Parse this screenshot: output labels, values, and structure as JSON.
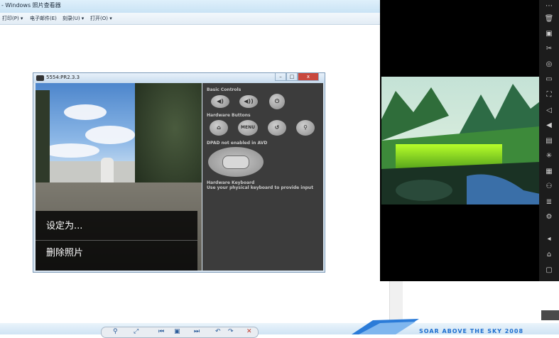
{
  "host": {
    "title": "- Windows 照片查看器",
    "menu": [
      "打印(P) ▾",
      "电子邮件(E)",
      "刻录(U) ▾",
      "打开(O) ▾"
    ]
  },
  "emulator": {
    "title": "5554:PR2.3.3",
    "controls": {
      "minimize": "–",
      "maximize": "□",
      "close": "x"
    },
    "context_menu": [
      "设定为...",
      "删除照片"
    ],
    "panel": {
      "basic_controls": "Basic Controls",
      "hardware_buttons": "Hardware Buttons",
      "menu_button": "MENU",
      "dpad_label": "DPAD not enabled in AVD",
      "keyboard_title": "Hardware Keyboard",
      "keyboard_hint": "Use your physical keyboard to provide input"
    }
  },
  "toolbar_icons": [
    "more-icon",
    "trash-icon",
    "screenshot-icon",
    "scissors-icon",
    "location-icon",
    "screen-icon",
    "fullscreen-icon",
    "volume-down-icon",
    "volume-up-icon",
    "install-icon",
    "shake-icon",
    "qr-icon",
    "gamepad-icon",
    "multi-instance-icon",
    "settings-icon",
    "back-icon",
    "home-icon",
    "recent-icon"
  ],
  "brand": {
    "text": "SOAR ABOVE THE SKY 2008"
  },
  "colors": {
    "emulator_panel": "#3c3c3c",
    "toolbar": "#1c1c1c",
    "accent_blue": "#1e6fd0"
  }
}
